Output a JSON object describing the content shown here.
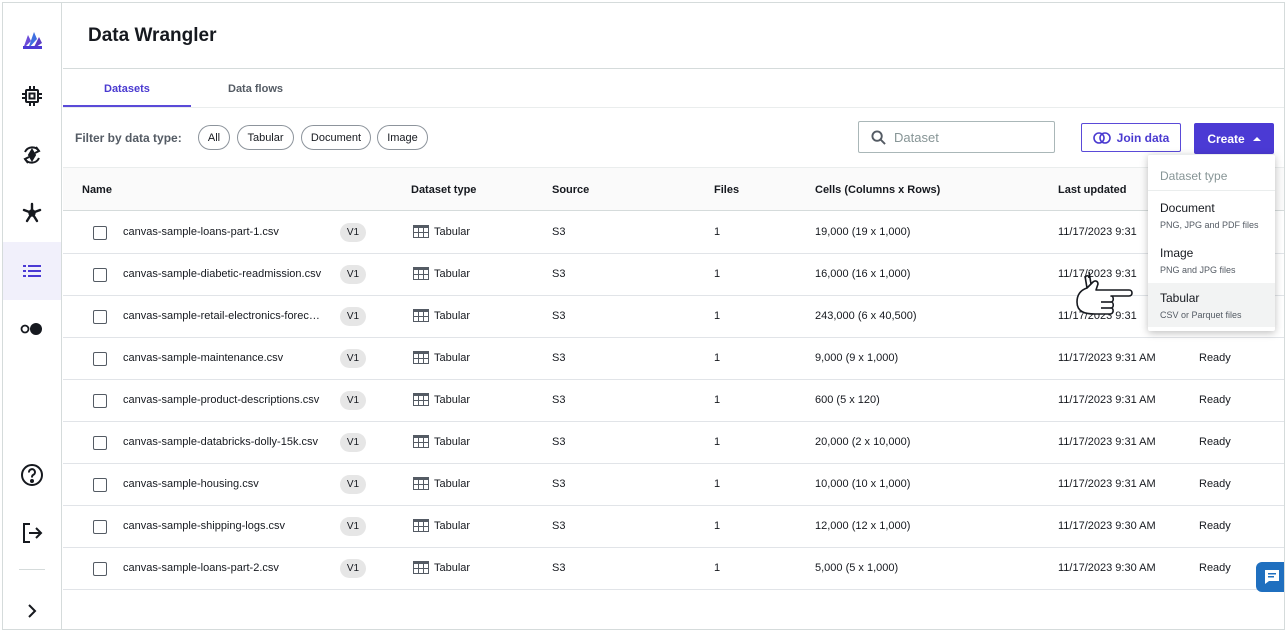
{
  "app": {
    "title": "Data Wrangler"
  },
  "tabs": [
    {
      "label": "Datasets",
      "active": true
    },
    {
      "label": "Data flows",
      "active": false
    }
  ],
  "filter": {
    "label": "Filter by data type:",
    "chips": [
      "All",
      "Tabular",
      "Document",
      "Image"
    ]
  },
  "search": {
    "placeholder": "Dataset",
    "value": ""
  },
  "actions": {
    "join_label": "Join data",
    "create_label": "Create"
  },
  "table": {
    "columns": [
      "Name",
      "Dataset type",
      "Source",
      "Files",
      "Cells (Columns x Rows)",
      "Last updated"
    ],
    "rows": [
      {
        "name": "canvas-sample-loans-part-1.csv",
        "version": "V1",
        "type": "Tabular",
        "source": "S3",
        "files": "1",
        "cells": "19,000 (19 x 1,000)",
        "updated": "11/17/2023 9:31",
        "status": ""
      },
      {
        "name": "canvas-sample-diabetic-readmission.csv",
        "version": "V1",
        "type": "Tabular",
        "source": "S3",
        "files": "1",
        "cells": "16,000 (16 x 1,000)",
        "updated": "11/17/2023 9:31",
        "status": ""
      },
      {
        "name": "canvas-sample-retail-electronics-forec…",
        "version": "V1",
        "type": "Tabular",
        "source": "S3",
        "files": "1",
        "cells": "243,000 (6 x 40,500)",
        "updated": "11/17/2023 9:31",
        "status": ""
      },
      {
        "name": "canvas-sample-maintenance.csv",
        "version": "V1",
        "type": "Tabular",
        "source": "S3",
        "files": "1",
        "cells": "9,000 (9 x 1,000)",
        "updated": "11/17/2023 9:31 AM",
        "status": "Ready"
      },
      {
        "name": "canvas-sample-product-descriptions.csv",
        "version": "V1",
        "type": "Tabular",
        "source": "S3",
        "files": "1",
        "cells": "600 (5 x 120)",
        "updated": "11/17/2023 9:31 AM",
        "status": "Ready"
      },
      {
        "name": "canvas-sample-databricks-dolly-15k.csv",
        "version": "V1",
        "type": "Tabular",
        "source": "S3",
        "files": "1",
        "cells": "20,000 (2 x 10,000)",
        "updated": "11/17/2023 9:31 AM",
        "status": "Ready"
      },
      {
        "name": "canvas-sample-housing.csv",
        "version": "V1",
        "type": "Tabular",
        "source": "S3",
        "files": "1",
        "cells": "10,000 (10 x 1,000)",
        "updated": "11/17/2023 9:31 AM",
        "status": "Ready"
      },
      {
        "name": "canvas-sample-shipping-logs.csv",
        "version": "V1",
        "type": "Tabular",
        "source": "S3",
        "files": "1",
        "cells": "12,000 (12 x 1,000)",
        "updated": "11/17/2023 9:30 AM",
        "status": "Ready"
      },
      {
        "name": "canvas-sample-loans-part-2.csv",
        "version": "V1",
        "type": "Tabular",
        "source": "S3",
        "files": "1",
        "cells": "5,000 (5 x 1,000)",
        "updated": "11/17/2023 9:30 AM",
        "status": "Ready"
      }
    ]
  },
  "dropdown": {
    "header": "Dataset type",
    "items": [
      {
        "title": "Document",
        "subtitle": "PNG, JPG and PDF files"
      },
      {
        "title": "Image",
        "subtitle": "PNG and JPG files"
      },
      {
        "title": "Tabular",
        "subtitle": "CSV or Parquet files"
      }
    ]
  },
  "colors": {
    "accent": "#4b3ad4",
    "active_nav_bg": "#f1f0fb",
    "chat": "#1f6fbf"
  },
  "icons": {
    "sidebar": [
      "logo-icon",
      "chip-icon",
      "refresh-model-icon",
      "asterisk-icon",
      "list-icon",
      "toggle-icon",
      "help-icon",
      "sign-out-icon",
      "expand-chevron-icon"
    ],
    "table_type": "table-grid-icon",
    "search": "search-icon",
    "join": "join-circles-icon",
    "create": "caret-up-icon",
    "chat": "chat-icon"
  }
}
